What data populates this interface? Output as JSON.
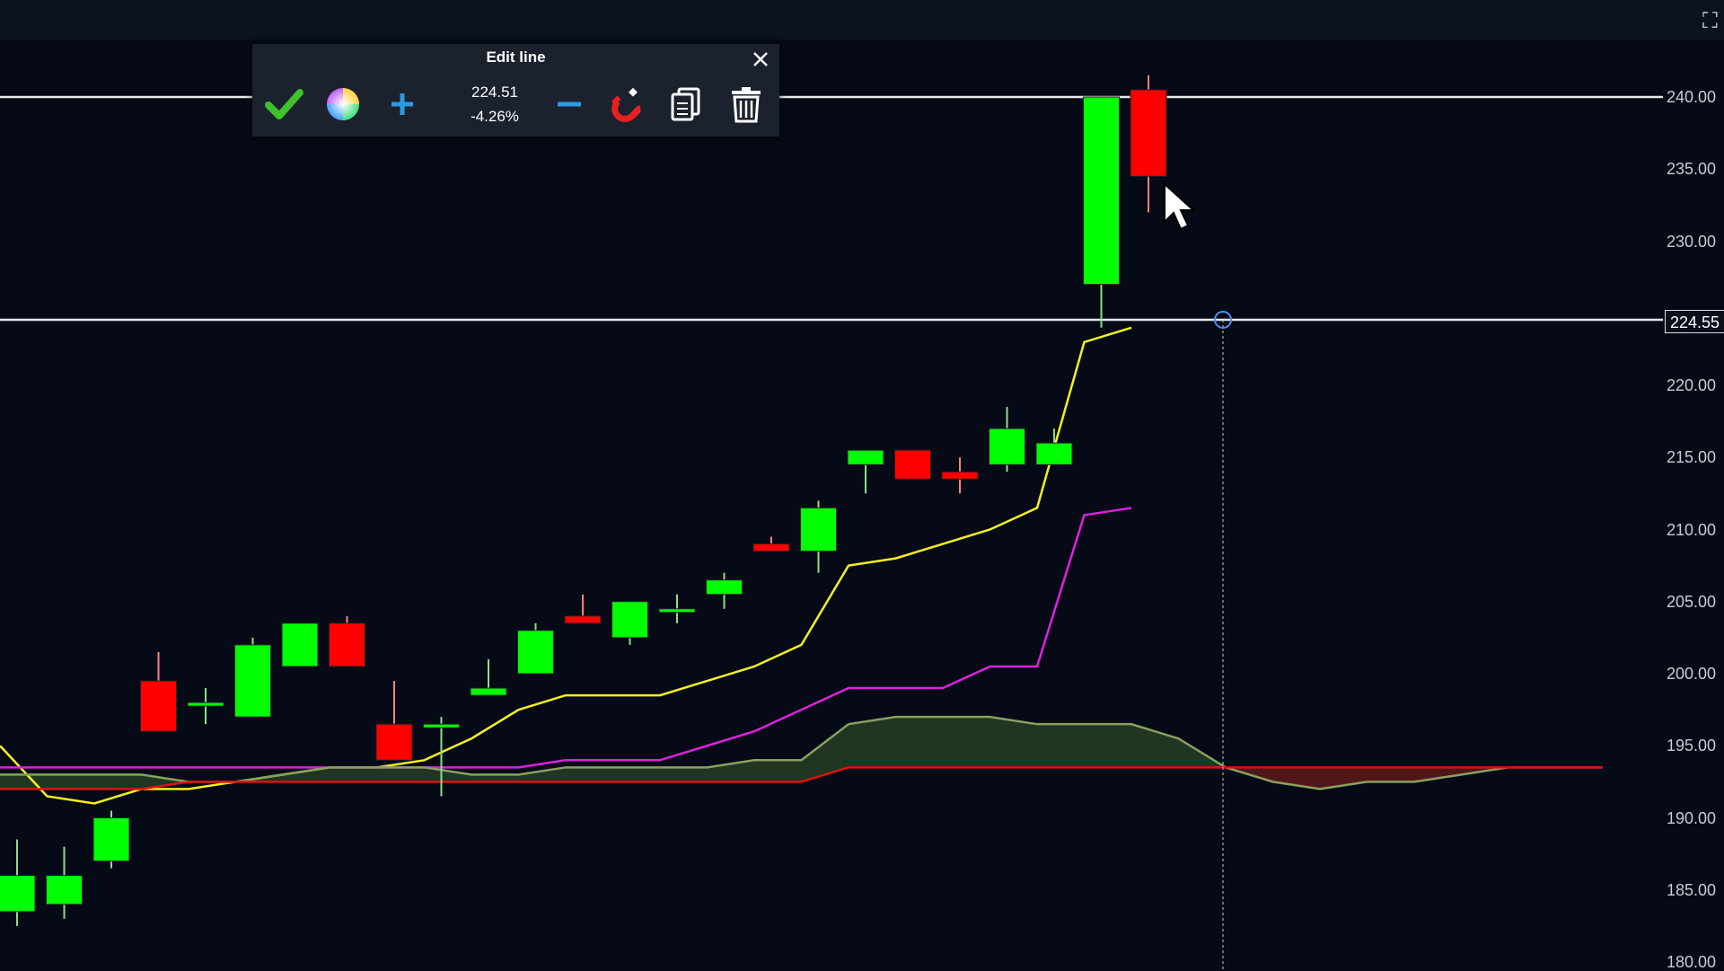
{
  "dialog": {
    "title": "Edit line",
    "price": "224.51",
    "percent": "-4.26%",
    "icons": [
      "checkmark-icon",
      "color-wheel-icon",
      "plus-icon",
      "minus-icon",
      "magnet-icon",
      "copy-icon",
      "trash-icon",
      "close-icon"
    ]
  },
  "price_axis": {
    "labels": [
      "240.00",
      "235.00",
      "230.00",
      "220.00",
      "215.00",
      "210.00",
      "205.00",
      "200.00",
      "195.00",
      "190.00",
      "185.00",
      "180.00"
    ],
    "current_line_price": "224.55"
  },
  "colors": {
    "background": "#050a16",
    "bull_candle": "#00ff00",
    "bear_candle": "#ff0000",
    "yellow_line": "#f5f01e",
    "magenta_line": "#e020e0",
    "olive_line": "#8aa060",
    "red_line": "#e01010",
    "cloud_green": "#253a25",
    "cloud_red": "#5a1818"
  },
  "chart_data": {
    "type": "candlestick",
    "ylim": [
      180,
      243
    ],
    "horizontal_lines": [
      240,
      224.55
    ],
    "candles": [
      {
        "o": 183.5,
        "h": 188.5,
        "l": 182.5,
        "c": 186.0
      },
      {
        "o": 184.0,
        "h": 188.0,
        "l": 183.0,
        "c": 186.0
      },
      {
        "o": 187.0,
        "h": 190.5,
        "l": 186.5,
        "c": 190.0
      },
      {
        "o": 199.5,
        "h": 201.5,
        "l": 196.0,
        "c": 196.0
      },
      {
        "o": 198.0,
        "h": 199.0,
        "l": 196.5,
        "c": 198.0
      },
      {
        "o": 197.0,
        "h": 202.5,
        "l": 197.0,
        "c": 202.0
      },
      {
        "o": 200.5,
        "h": 203.5,
        "l": 200.5,
        "c": 203.5
      },
      {
        "o": 203.5,
        "h": 204.0,
        "l": 200.5,
        "c": 200.5
      },
      {
        "o": 196.5,
        "h": 199.5,
        "l": 194.0,
        "c": 194.0
      },
      {
        "o": 196.5,
        "h": 197.0,
        "l": 191.5,
        "c": 196.5
      },
      {
        "o": 198.5,
        "h": 201.0,
        "l": 198.5,
        "c": 199.0
      },
      {
        "o": 200.0,
        "h": 203.5,
        "l": 200.0,
        "c": 203.0
      },
      {
        "o": 204.0,
        "h": 205.5,
        "l": 203.5,
        "c": 203.5
      },
      {
        "o": 202.5,
        "h": 205.0,
        "l": 202.0,
        "c": 205.0
      },
      {
        "o": 204.5,
        "h": 205.5,
        "l": 203.5,
        "c": 204.5
      },
      {
        "o": 205.5,
        "h": 207.0,
        "l": 204.5,
        "c": 206.5
      },
      {
        "o": 209.0,
        "h": 209.5,
        "l": 208.5,
        "c": 208.5
      },
      {
        "o": 208.5,
        "h": 212.0,
        "l": 207.0,
        "c": 211.5
      },
      {
        "o": 214.5,
        "h": 215.5,
        "l": 212.5,
        "c": 215.5
      },
      {
        "o": 215.5,
        "h": 215.5,
        "l": 213.5,
        "c": 213.5
      },
      {
        "o": 214.0,
        "h": 215.0,
        "l": 212.5,
        "c": 213.5
      },
      {
        "o": 214.5,
        "h": 218.5,
        "l": 214.0,
        "c": 217.0
      },
      {
        "o": 214.5,
        "h": 217.0,
        "l": 214.5,
        "c": 216.0
      },
      {
        "o": 227.0,
        "h": 240.0,
        "l": 224.0,
        "c": 240.0
      },
      {
        "o": 240.5,
        "h": 241.5,
        "l": 232.0,
        "c": 234.5
      }
    ],
    "lines": [
      {
        "name": "yellow",
        "values": [
          195.0,
          191.5,
          191.0,
          192.0,
          192.0,
          192.5,
          193.0,
          193.5,
          193.5,
          194.0,
          195.5,
          197.5,
          198.5,
          198.5,
          198.5,
          199.5,
          200.5,
          202.0,
          207.5,
          208.0,
          209.0,
          210.0,
          211.5,
          223.0,
          224.0
        ]
      },
      {
        "name": "magenta",
        "values": [
          193.5,
          193.5,
          193.5,
          193.5,
          193.5,
          193.5,
          193.5,
          193.5,
          193.5,
          193.5,
          193.5,
          193.5,
          194.0,
          194.0,
          194.0,
          195.0,
          196.0,
          197.5,
          199.0,
          199.0,
          199.0,
          200.5,
          200.5,
          211.0,
          211.5
        ]
      },
      {
        "name": "olive",
        "values": [
          193.0,
          193.0,
          193.0,
          193.0,
          192.5,
          192.5,
          193.0,
          193.5,
          193.5,
          193.5,
          193.0,
          193.0,
          193.5,
          193.5,
          193.5,
          193.5,
          194.0,
          194.0,
          196.5,
          197.0,
          197.0,
          197.0,
          196.5,
          196.5,
          196.5,
          195.5,
          193.5,
          192.5,
          192.0,
          192.5,
          192.5,
          193.0,
          193.5,
          193.5,
          193.5
        ]
      },
      {
        "name": "red",
        "values": [
          192.0,
          192.0,
          192.0,
          192.0,
          192.5,
          192.5,
          192.5,
          192.5,
          192.5,
          192.5,
          192.5,
          192.5,
          192.5,
          192.5,
          192.5,
          192.5,
          192.5,
          192.5,
          193.5,
          193.5,
          193.5,
          193.5,
          193.5,
          193.5,
          193.5,
          193.5,
          193.5,
          193.5,
          193.5,
          193.5,
          193.5,
          193.5,
          193.5,
          193.5,
          193.5
        ]
      }
    ]
  }
}
